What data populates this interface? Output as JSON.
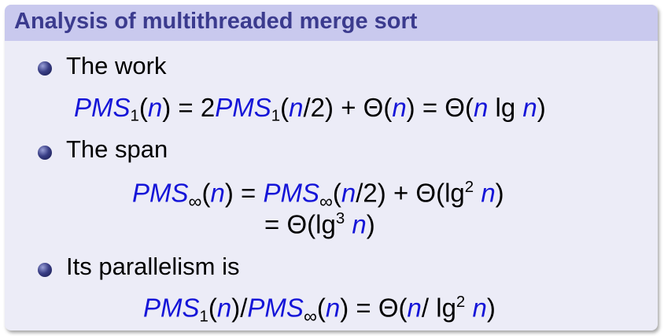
{
  "block": {
    "title": "Analysis of multithreaded merge sort"
  },
  "items": [
    {
      "label": "The work"
    },
    {
      "label": "The span"
    },
    {
      "label": "Its parallelism is"
    }
  ],
  "math": {
    "PMS": "PMS",
    "n": "n",
    "sub_one": "1",
    "sub_inf": "∞",
    "lg": "lg",
    "sup_two": "2",
    "sup_three": "3",
    "theta": "Θ",
    "eq_sign": "=",
    "plus": "+",
    "two": "2",
    "slash": "/"
  },
  "colors": {
    "title_bar": "#c9c9ee",
    "title_text": "#3b3b8e",
    "block_body": "#ececf7",
    "math_blue": "#1515d8"
  }
}
